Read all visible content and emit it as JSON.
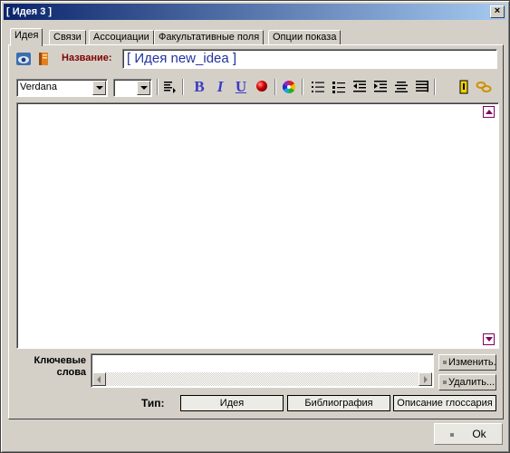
{
  "window": {
    "title": "[ Идея 3 ]",
    "close_glyph": "×"
  },
  "tabs": [
    {
      "label": "Идея",
      "active": true
    },
    {
      "label": "Связи",
      "active": false
    },
    {
      "label": "Ассоциации",
      "active": false
    },
    {
      "label": "Факультативные поля",
      "active": false
    },
    {
      "label": "Опции показа",
      "active": false
    }
  ],
  "header": {
    "name_label": "Название:",
    "name_value": "[ Идея new_idea ]",
    "icons": [
      "eye-icon",
      "book-icon"
    ]
  },
  "toolbar": {
    "font_family": "Verdana",
    "font_size": "",
    "bold": "B",
    "italic": "I",
    "underline": "U",
    "icons": [
      "text-direction-icon",
      "bold-icon",
      "italic-icon",
      "underline-icon",
      "red-ball-icon",
      "color-wheel-icon",
      "numbered-list-icon",
      "bullet-list-icon",
      "outdent-icon",
      "indent-icon",
      "align-center-icon",
      "align-justify-icon",
      "bookmark-icon",
      "link-icon"
    ]
  },
  "editor": {
    "content": ""
  },
  "keywords": {
    "label": "Ключевые слова",
    "value": "",
    "edit_button": "Изменить...",
    "delete_button": "Удалить..."
  },
  "type": {
    "label": "Тип:",
    "options": [
      "Идея",
      "Библиография",
      "Описание глоссария"
    ]
  },
  "footer": {
    "ok_button": "Ok"
  },
  "colors": {
    "titlebar_start": "#0a246a",
    "titlebar_end": "#a6caf0",
    "name_label": "#800000",
    "name_value": "#2233a0",
    "format_buttons": "#3a3ac8",
    "scroll_arrows": "#800060"
  }
}
